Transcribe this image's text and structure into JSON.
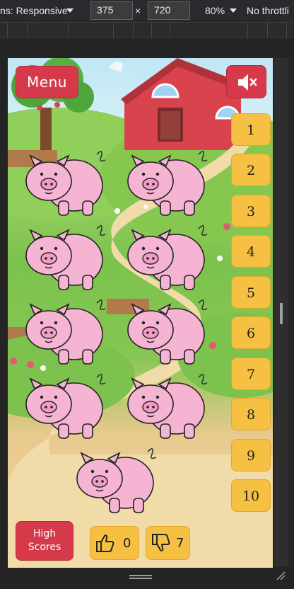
{
  "devtools": {
    "dimensions_label": "ns: Responsive",
    "width": "375",
    "height": "720",
    "times": "×",
    "zoom": "80%",
    "throttle": "No throttli"
  },
  "game": {
    "menu_label": "Menu",
    "mute_icon": "speaker-muted-icon",
    "number_buttons": [
      "1",
      "2",
      "3",
      "4",
      "5",
      "6",
      "7",
      "8",
      "9",
      "10"
    ],
    "pig_count": 9,
    "high_scores_label_line1": "High",
    "high_scores_label_line2": "Scores",
    "thumbs_up_count": "0",
    "thumbs_down_count": "7",
    "colors": {
      "red_button": "#d63a4a",
      "yellow_button": "#f6c043",
      "pig_pink": "#f5b4d2"
    }
  }
}
